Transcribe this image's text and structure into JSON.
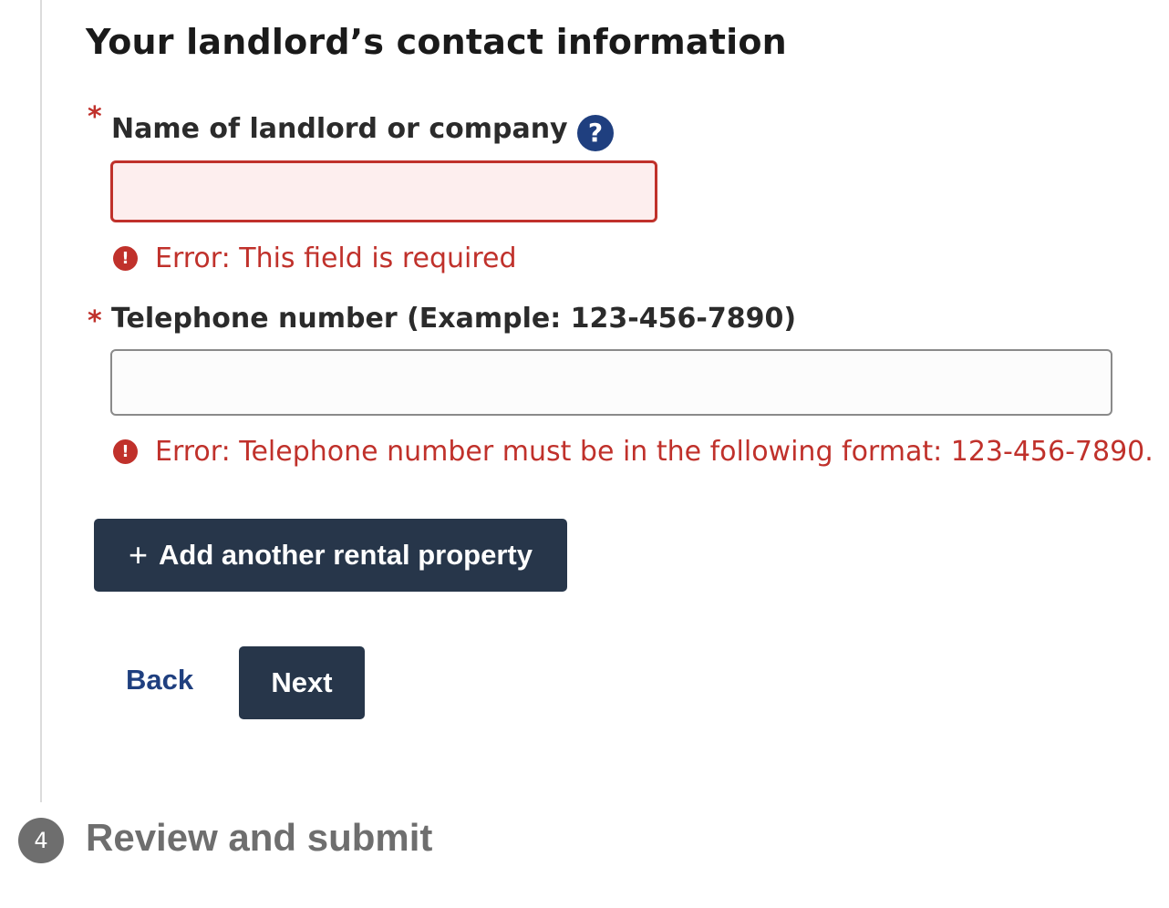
{
  "section": {
    "title": "Your landlord’s contact information"
  },
  "fields": {
    "landlord_name": {
      "required_marker": "*",
      "label": "Name of landlord or company",
      "help_icon": "?",
      "value": "",
      "error": "Error: This field is required"
    },
    "telephone": {
      "required_marker": "*",
      "label": "Telephone number (Example: 123-456-7890)",
      "value": "",
      "error": "Error: Telephone number must be in the following format: 123-456-7890."
    },
    "error_icon": "!"
  },
  "buttons": {
    "add_property_icon": "+",
    "add_property_label": "Add another rental property",
    "back_label": "Back",
    "next_label": "Next"
  },
  "next_step": {
    "number": "4",
    "title": "Review and submit"
  },
  "colors": {
    "error": "#c0312b",
    "error_bg": "#fdeeee",
    "primary_dark": "#27364a",
    "link": "#1f3f7f",
    "inactive_step": "#6e6e6e"
  }
}
